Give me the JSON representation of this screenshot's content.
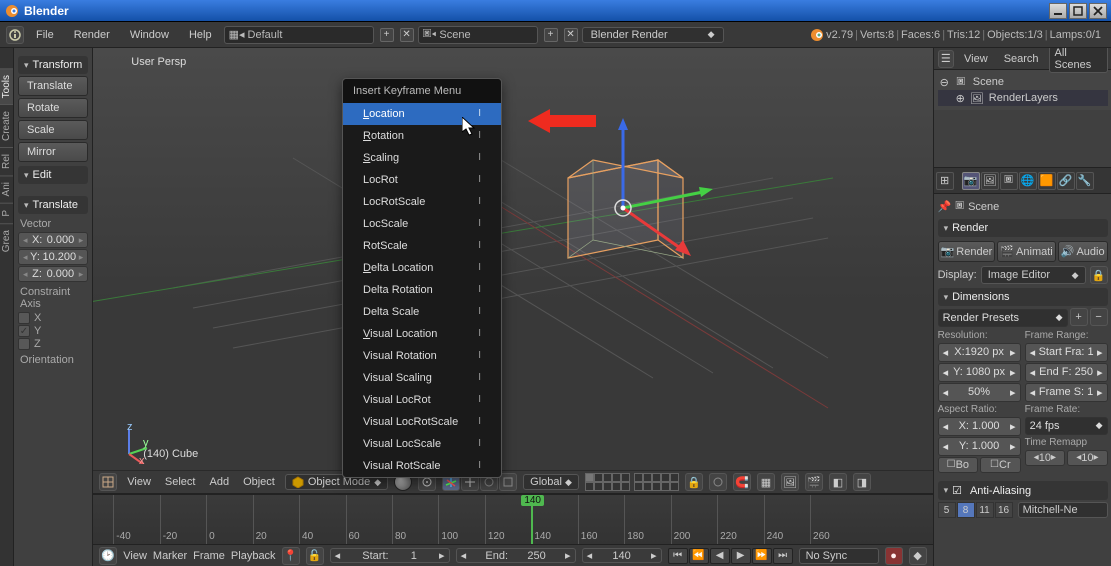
{
  "window": {
    "title": "Blender"
  },
  "top_menu": {
    "items": [
      "File",
      "Render",
      "Window",
      "Help"
    ],
    "layout_preset": "Default",
    "scene": "Scene",
    "engine": "Blender Render",
    "version": "v2.79",
    "stats": {
      "verts": "Verts:8",
      "faces": "Faces:6",
      "tris": "Tris:12",
      "objects": "Objects:1/3",
      "lamps": "Lamps:0/1"
    }
  },
  "left_tabs": [
    "Tools",
    "Create",
    "Rel",
    "Ani",
    "P",
    "Grea"
  ],
  "transform_panel": {
    "title": "Transform",
    "buttons": [
      "Translate",
      "Rotate",
      "Scale",
      "Mirror"
    ]
  },
  "edit_panel": {
    "title": "Edit"
  },
  "translate_panel": {
    "title": "Translate",
    "vector_label": "Vector",
    "x": "0.000",
    "y": "10.200",
    "z": "0.000",
    "constraint_label": "Constraint Axis",
    "cx": "X",
    "cy": "Y",
    "cz": "Z",
    "orientation_label": "Orientation"
  },
  "viewport": {
    "label": "User Persp",
    "object_label": "(140) Cube",
    "mode": "Object Mode",
    "orientation": "Global"
  },
  "viewport_header_items": [
    "View",
    "Select",
    "Add",
    "Object"
  ],
  "keyframe_menu": {
    "title": "Insert Keyframe Menu",
    "shortcut": "I",
    "items": [
      {
        "label": "Location",
        "hover": true,
        "u": "L"
      },
      {
        "label": "Rotation",
        "u": "R"
      },
      {
        "label": "Scaling",
        "u": "S"
      },
      {
        "label": "LocRot"
      },
      {
        "label": "LocRotScale"
      },
      {
        "label": "LocScale"
      },
      {
        "label": "RotScale"
      },
      {
        "label": "Delta Location",
        "u": "D"
      },
      {
        "label": "Delta Rotation"
      },
      {
        "label": "Delta Scale"
      },
      {
        "label": "Visual Location",
        "u": "V"
      },
      {
        "label": "Visual Rotation"
      },
      {
        "label": "Visual Scaling"
      },
      {
        "label": "Visual LocRot"
      },
      {
        "label": "Visual LocRotScale"
      },
      {
        "label": "Visual LocScale"
      },
      {
        "label": "Visual RotScale"
      }
    ]
  },
  "timeline": {
    "ticks": [
      "-40",
      "-20",
      "0",
      "20",
      "40",
      "60",
      "80",
      "100",
      "120",
      "140",
      "160",
      "180",
      "200",
      "220",
      "240",
      "260"
    ],
    "current": "140",
    "start_label": "Start:",
    "start": "1",
    "end_label": "End:",
    "end": "250",
    "sync": "No Sync",
    "header_items": [
      "View",
      "Marker",
      "Frame",
      "Playback"
    ]
  },
  "outliner": {
    "view": "View",
    "search": "Search",
    "scope": "All Scenes",
    "scene": "Scene",
    "layer": "RenderLayers"
  },
  "props": {
    "scene": "Scene",
    "render_title": "Render",
    "render_btn": "Render",
    "anim_btn": "Animati",
    "audio_btn": "Audio",
    "display_label": "Display:",
    "display_value": "Image Editor",
    "dimensions_title": "Dimensions",
    "presets": "Render Presets",
    "resolution_label": "Resolution:",
    "res_x": "X:1920 px",
    "res_y": "Y: 1080 px",
    "res_pct": "50%",
    "aspect_label": "Aspect Ratio:",
    "asp_x": "X:     1.000",
    "asp_y": "Y:     1.000",
    "border": "Bo",
    "crop": "Cr",
    "frame_range_label": "Frame Range:",
    "start_frame": "Start Fra: 1",
    "end_frame": "End F: 250",
    "frame_step": "Frame S: 1",
    "frame_rate_label": "Frame Rate:",
    "fps": "24 fps",
    "time_remap": "Time Remapp",
    "remap_old": "10",
    "remap_new": "10",
    "aa_title": "Anti-Aliasing",
    "samples": [
      "5",
      "8",
      "11",
      "16"
    ],
    "active_sample": "8",
    "aa_filter": "Mitchell-Ne"
  }
}
